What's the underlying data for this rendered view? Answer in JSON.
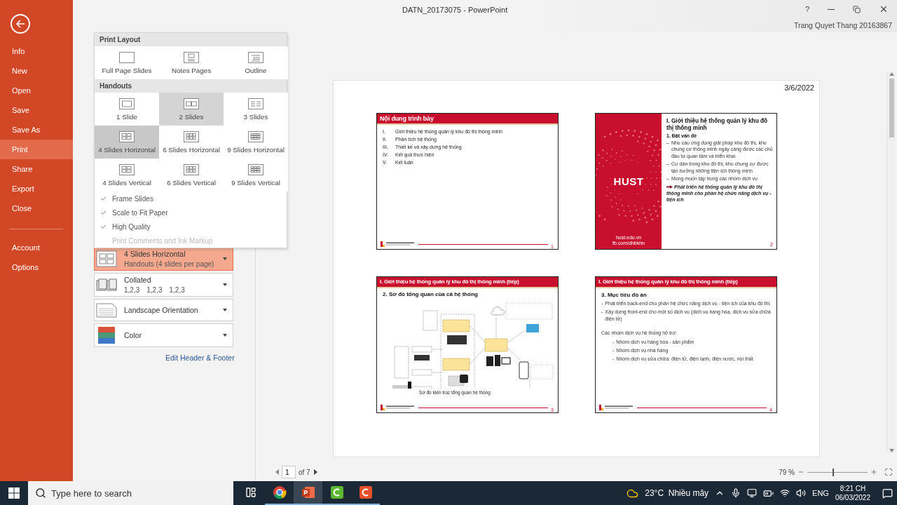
{
  "window": {
    "title": "DATN_20173075 - PowerPoint",
    "user": "Trang Quyet Thang 20163867",
    "help": "?"
  },
  "backstage": {
    "items": [
      {
        "label": "Info",
        "selected": false
      },
      {
        "label": "New",
        "selected": false
      },
      {
        "label": "Open",
        "selected": false
      },
      {
        "label": "Save",
        "selected": false
      },
      {
        "label": "Save As",
        "selected": false
      },
      {
        "label": "Print",
        "selected": true
      },
      {
        "label": "Share",
        "selected": false
      },
      {
        "label": "Export",
        "selected": false
      },
      {
        "label": "Close",
        "selected": false
      }
    ],
    "bottom_items": [
      {
        "label": "Account",
        "selected": false
      },
      {
        "label": "Options",
        "selected": false
      }
    ]
  },
  "layout_menu": {
    "sections": [
      {
        "title": "Print Layout",
        "options": [
          {
            "label": "Full Page Slides",
            "kind": "full",
            "selected": false,
            "hovered": false
          },
          {
            "label": "Notes Pages",
            "kind": "notes",
            "selected": false,
            "hovered": false
          },
          {
            "label": "Outline",
            "kind": "outline",
            "selected": false,
            "hovered": false
          }
        ]
      },
      {
        "title": "Handouts",
        "options": [
          {
            "label": "1 Slide",
            "kind": "one",
            "selected": false,
            "hovered": false
          },
          {
            "label": "2 Slides",
            "kind": "two",
            "selected": false,
            "hovered": true
          },
          {
            "label": "3 Slides",
            "kind": "three",
            "selected": false,
            "hovered": false
          },
          {
            "label": "4 Slides Horizontal",
            "kind": "four",
            "selected": true,
            "hovered": false
          },
          {
            "label": "6 Slides Horizontal",
            "kind": "six",
            "selected": false,
            "hovered": false
          },
          {
            "label": "9 Slides Horizontal",
            "kind": "nine",
            "selected": false,
            "hovered": false
          },
          {
            "label": "4 Slides Vertical",
            "kind": "four",
            "selected": false,
            "hovered": false
          },
          {
            "label": "6 Slides Vertical",
            "kind": "six",
            "selected": false,
            "hovered": false
          },
          {
            "label": "9 Slides Vertical",
            "kind": "nine",
            "selected": false,
            "hovered": false
          }
        ]
      }
    ],
    "toggles": [
      {
        "label": "Frame Slides",
        "checked": true,
        "disabled": false
      },
      {
        "label": "Scale to Fit Paper",
        "checked": true,
        "disabled": false
      },
      {
        "label": "High Quality",
        "checked": true,
        "disabled": false
      },
      {
        "label": "Print Comments and Ink Markup",
        "checked": false,
        "disabled": true
      }
    ]
  },
  "settings": [
    {
      "kind": "layout",
      "title": "4 Slides Horizontal",
      "subtitle": "Handouts (4 slides per page)",
      "open": true
    },
    {
      "kind": "collate",
      "title": "Collated",
      "values": [
        "1,2,3",
        "1,2,3",
        "1,2,3"
      ],
      "open": false
    },
    {
      "kind": "orientation",
      "title": "Landscape Orientation",
      "open": false
    },
    {
      "kind": "color",
      "title": "Color",
      "open": false
    }
  ],
  "header_footer_link": "Edit Header & Footer",
  "preview": {
    "date": "3/6/2022",
    "slides": [
      {
        "kind": "agenda",
        "title": "Nội dung trình bày",
        "items": [
          {
            "num": "I.",
            "text": "Giới thiệu hệ thống quản lý khu đô thị thông minh"
          },
          {
            "num": "II.",
            "text": "Phân tích hệ thống"
          },
          {
            "num": "III.",
            "text": "Thiết kế và xây dựng hệ thống"
          },
          {
            "num": "IV.",
            "text": "Kết quả thực hiện"
          },
          {
            "num": "V.",
            "text": "Kết luận"
          }
        ],
        "number": "1"
      },
      {
        "kind": "cover",
        "marker": "–",
        "brand": "HUST",
        "links": [
          "hust.edu.vn",
          "fb.com/dhbkhn"
        ],
        "title": "I. Giới thiệu hệ thống quản lý khu đô thị thông minh",
        "subtitle": "1. Đặt vấn đề",
        "bullets": [
          "Nhu cầu ứng dụng giải pháp khu đô thị, khu chung cư thông minh ngày càng được các chủ đầu tư quan tâm và triển khai.",
          "Cư dân trong khu đô thị, khu chung cư được tận hưởng những tiện ích thông minh",
          "Mong muốn tập trung các nhóm dịch vụ"
        ],
        "conclusion": "Phát triển hệ thống quản lý khu đô thị thông minh cho phân hệ chức năng dịch vụ - tiện ích",
        "number": "2"
      },
      {
        "kind": "diagram",
        "title": "I. Giới thiệu hệ thống quản lý khu đô thị thông minh (tiếp)",
        "subtitle": "2. Sơ đồ tổng quan của cả hệ thống",
        "caption": "Sơ đồ kiến trúc tổng quan hệ thống",
        "number": "3"
      },
      {
        "kind": "goals",
        "marker": "-",
        "title": "I. Giới thiệu hệ thống quản lý khu đô thị thông minh (tiếp)",
        "subtitle": "3. Mục tiêu đồ án",
        "bullets": [
          "Phát triển back-end cho phân hệ chức năng dịch vụ - tiện ích của khu đô thị.",
          "Xây dựng front-end cho một số dịch vụ (dịch vụ hàng hóa, dịch vụ sửa chữa điện tử)"
        ],
        "groups_title": "Các nhóm dịch vụ hệ thống hỗ trợ:",
        "groups": [
          "Nhóm dịch vụ hàng hóa - sản phẩm",
          "Nhóm dịch vụ nhà hàng",
          "Nhóm dịch vụ sửa chữa: điện tử, điện lạnh, điện nước, nội thất"
        ],
        "number": "4"
      }
    ]
  },
  "page_nav": {
    "page": "1",
    "of": "of 7"
  },
  "zoom": {
    "reading": "79 %",
    "level": 0.42
  },
  "taskbar": {
    "search_placeholder": "Type here to search",
    "apps": [
      {
        "kind": "chrome",
        "active": false
      },
      {
        "kind": "powerpoint",
        "active": true
      },
      {
        "kind": "camtasia-green",
        "active": false
      },
      {
        "kind": "camtasia-orange",
        "active": false
      }
    ],
    "weather": "23°C  Nhiều mây",
    "language": "ENG",
    "time": "8:21 CH",
    "date": "06/03/2022"
  }
}
